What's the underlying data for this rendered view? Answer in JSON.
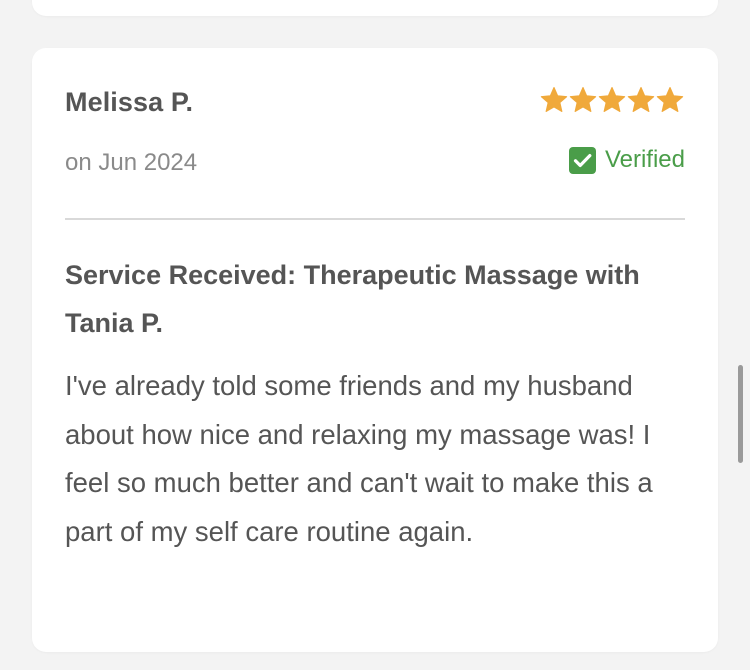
{
  "review": {
    "reviewer_name": "Melissa P.",
    "rating": 5,
    "max_rating": 5,
    "date": "on Jun 2024",
    "verified_label": "Verified",
    "service_title": "Service Received: Therapeutic Massage with Tania P.",
    "body": "I've already told some friends and my husband about how nice and relaxing my massage was! I feel so much better and can't wait to make this a part of my self care routine again."
  },
  "colors": {
    "star": "#f0a93b",
    "verified": "#4a9d49",
    "background": "#f3f3f3",
    "card": "#ffffff"
  },
  "icons": {
    "rating": "star-icon",
    "verified": "checkbox-check-icon"
  }
}
